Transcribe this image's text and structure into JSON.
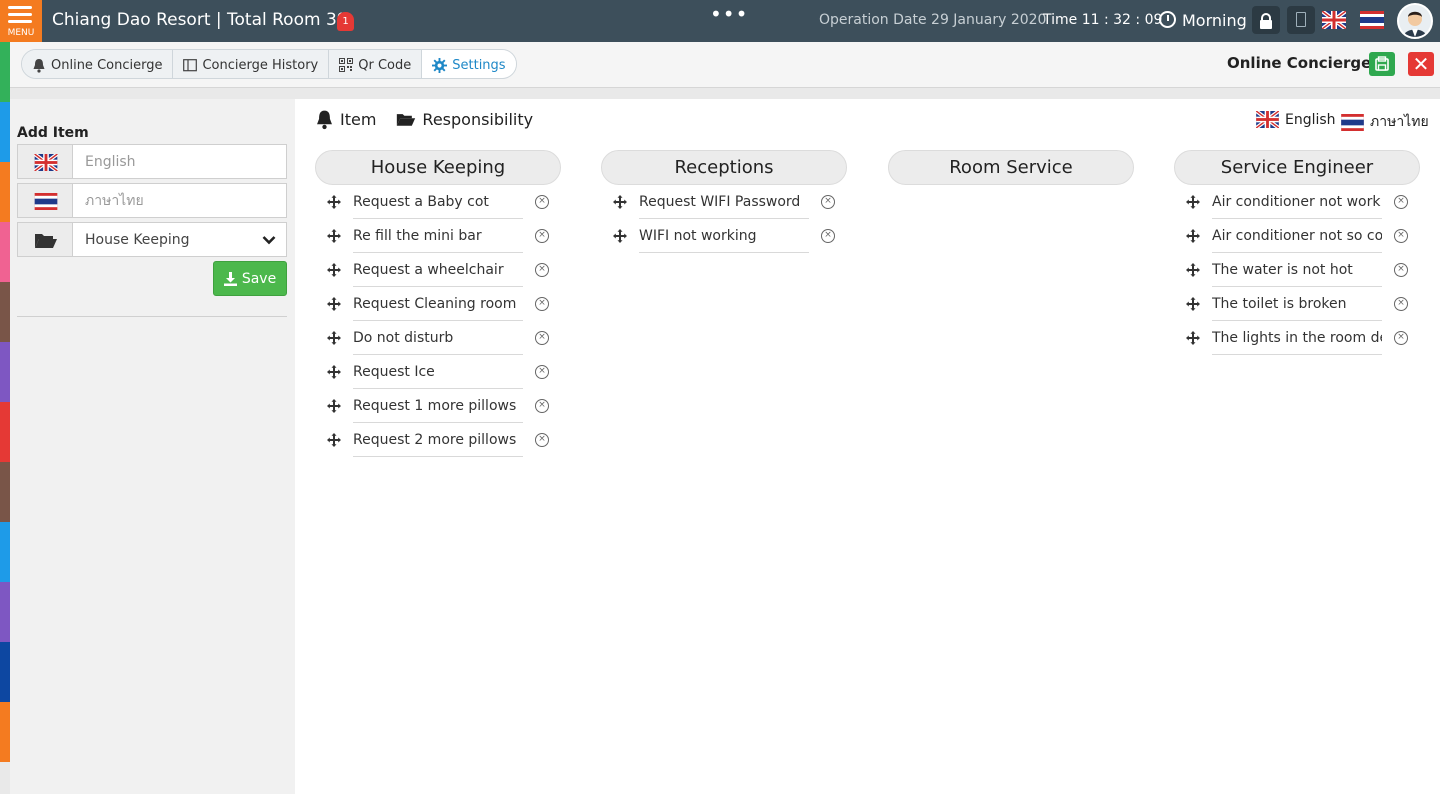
{
  "topbar": {
    "menu_label": "MENU",
    "title": "Chiang Dao Resort | Total Room 39",
    "notification_count": "1",
    "more_dots": "•••",
    "operation_date": "Operation Date 29 January 2020",
    "time": "Time 11 : 32 : 09",
    "shift": "Morning"
  },
  "tabs": [
    {
      "label": "Online Concierge",
      "icon": "bell-icon"
    },
    {
      "label": "Concierge History",
      "icon": "book-icon"
    },
    {
      "label": "Qr Code",
      "icon": "qr-icon"
    },
    {
      "label": "Settings",
      "icon": "gear-icon"
    }
  ],
  "page_label": "Online Concierge",
  "close_glyph": "✕",
  "add_item": {
    "title": "Add Item",
    "english_placeholder": "English",
    "thai_placeholder": "ภาษาไทย",
    "category_selected": "House Keeping",
    "save_label": "Save"
  },
  "subnav": {
    "item_label": "Item",
    "responsibility_label": "Responsibility"
  },
  "languages": {
    "english": "English",
    "thai": "ภาษาไทย"
  },
  "columns": [
    {
      "title": "House Keeping",
      "items": [
        "Request a Baby cot",
        "Re fill the mini bar",
        "Request a wheelchair",
        "Request Cleaning room",
        "Do not disturb",
        "Request Ice",
        "Request 1 more pillows",
        "Request 2 more pillows"
      ]
    },
    {
      "title": "Receptions",
      "items": [
        "Request WIFI Password",
        "WIFI not working"
      ]
    },
    {
      "title": "Room Service",
      "items": []
    },
    {
      "title": "Service Engineer",
      "items": [
        "Air conditioner not work",
        "Air conditioner not so co",
        "The water is not hot",
        "The toilet is broken",
        "The lights in the room de"
      ]
    }
  ],
  "colors": {
    "topbar": "#3d4f5b",
    "menu": "#f47b20",
    "accent": "#1e88c7",
    "save": "#4cb84c",
    "print": "#2fa84f",
    "close": "#e53935",
    "strip": [
      "#33b15a",
      "#1e9be8",
      "#f47b20",
      "#f06292",
      "#795548",
      "#7e57c2",
      "#e53935",
      "#795548",
      "#1e9be8",
      "#7e57c2",
      "#0d47a1",
      "#f47b20"
    ]
  }
}
